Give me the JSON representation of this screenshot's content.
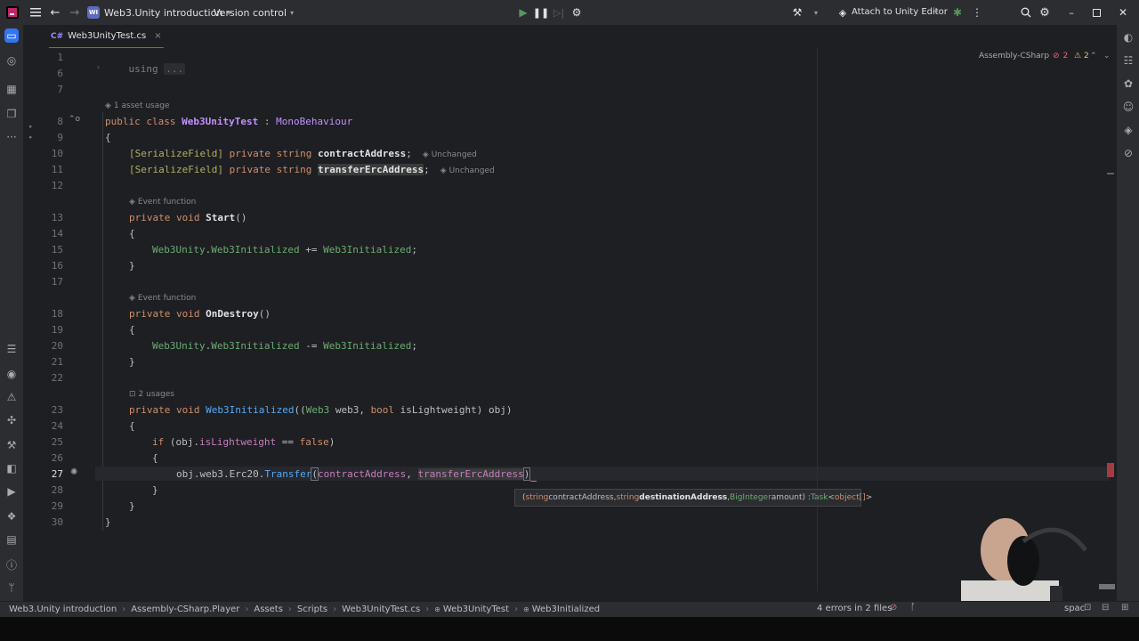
{
  "topbar": {
    "project_badge": "WI",
    "project_name": "Web3.Unity introduction",
    "vcs_label": "Version control",
    "attach_label": "Attach to Unity Editor"
  },
  "tab": {
    "badge": "C#",
    "filename": "Web3UnityTest.cs",
    "close": "×"
  },
  "editor": {
    "assembly": "Assembly-CSharp",
    "errors": "2",
    "warnings": "2",
    "hints": {
      "asset_usage": "1 asset usage",
      "event_function_1": "Event function",
      "event_function_2": "Event function",
      "usages": "2 usages",
      "unchanged_1": "Unchanged",
      "unchanged_2": "Unchanged"
    },
    "line_numbers": [
      "1",
      "6",
      "7",
      "8",
      "9",
      "10",
      "11",
      "12",
      "13",
      "14",
      "15",
      "16",
      "17",
      "18",
      "19",
      "20",
      "21",
      "22",
      "23",
      "24",
      "25",
      "26",
      "27",
      "28",
      "29",
      "30"
    ],
    "code": {
      "l1_kw": "using",
      "l1_fold": "...",
      "l8_public": "public",
      "l8_class": "class",
      "l8_name": "Web3UnityTest",
      "l8_colon": " : ",
      "l8_base": "MonoBehaviour",
      "brace_open": "{",
      "brace_close": "}",
      "attr": "[SerializeField]",
      "private": "private",
      "string": "string",
      "field1": "contractAddress",
      "field2": "transferErcAddress",
      "semi": ";",
      "void": "void",
      "start": "Start",
      "on_destroy": "OnDestroy",
      "parens": "()",
      "web3unity": "Web3Unity",
      "dot": ".",
      "web3init_evt": "Web3Initialized",
      "plus_eq": " += ",
      "minus_eq": " -= ",
      "handler": "Web3Initialized",
      "l23_method": "Web3Initialized",
      "l23_params_a": "((",
      "l23_web3type": "Web3",
      "l23_web3": " web3, ",
      "l23_bool": "bool",
      "l23_islight": " isLightweight",
      "l23_params_b": ") obj)",
      "l25_if": "if",
      "l25_cond_a": " (obj.",
      "l25_islight": "isLightweight",
      "l25_cond_b": " == ",
      "l25_false": "false",
      "l25_cond_c": ")",
      "l27_obj": "obj.web3.Erc20.",
      "l27_transfer": "Transfer",
      "l27_open": "(",
      "l27_arg1": "contractAddress",
      "l27_comma": ", ",
      "l27_arg2": "transferErcAddress",
      "l27_close": ")"
    }
  },
  "tooltip": {
    "open": "(",
    "t1": "string",
    "p1": " contractAddress, ",
    "t2": "string",
    "p2": " destinationAddress",
    "sep": ", ",
    "t3": "BigInteger",
    "p3": " amount",
    "close": ") : ",
    "ret": "Task",
    "gen_open": "<",
    "gen": "object[]",
    "gen_close": ">"
  },
  "statusbar": {
    "crumbs": [
      "Web3.Unity introduction",
      "Assembly-CSharp.Player",
      "Assets",
      "Scripts",
      "Web3UnityTest.cs",
      "Web3UnityTest",
      "Web3Initialized"
    ],
    "errors_summary": "4 errors in 2 files",
    "right_text": "spac"
  },
  "colors": {
    "accent": "#3574f0",
    "error": "#e06c75",
    "keyword": "#cf8e6d",
    "method": "#56a8f5",
    "field": "#c77dbb",
    "class": "#c191ff",
    "event": "#6aab73"
  }
}
